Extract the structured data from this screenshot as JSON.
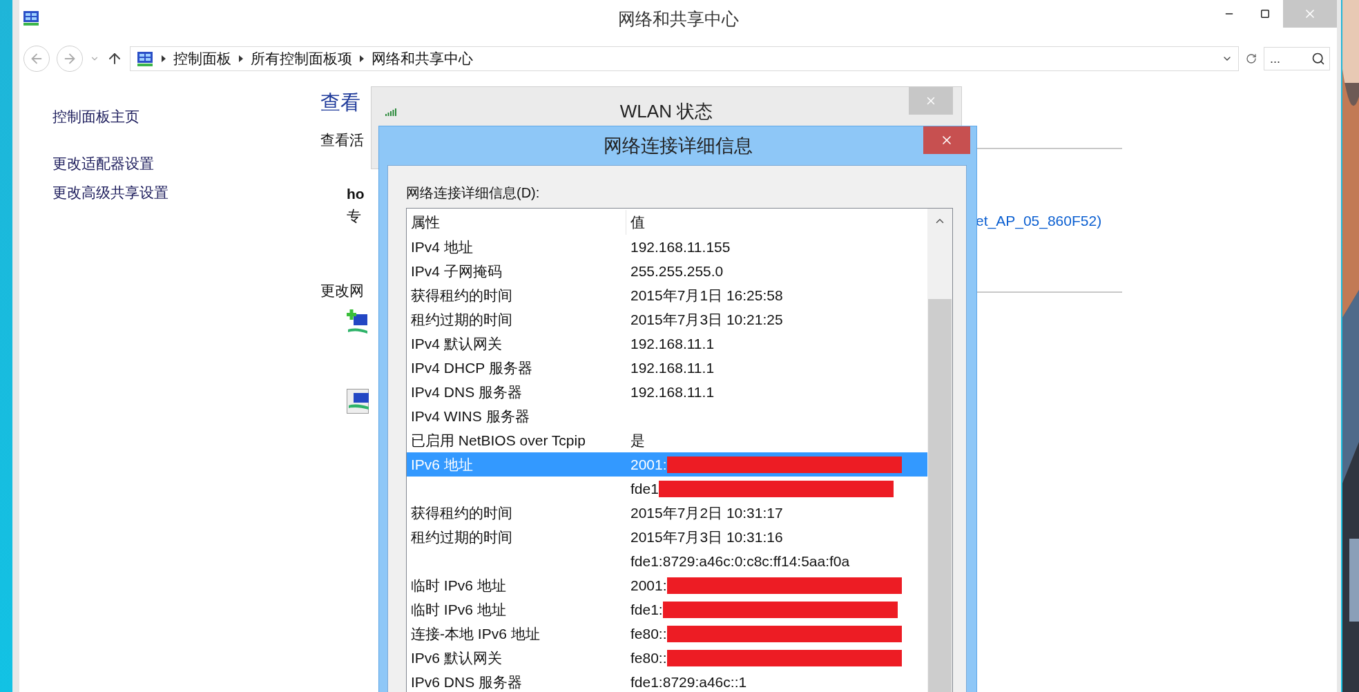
{
  "window": {
    "title": "网络和共享中心"
  },
  "address_bar": {
    "breadcrumbs": [
      "控制面板",
      "所有控制面板项",
      "网络和共享中心"
    ],
    "search_placeholder": "..."
  },
  "sidebar": {
    "links": [
      "控制面板主页",
      "更改适配器设置",
      "更改高级共享设置"
    ]
  },
  "main": {
    "heading": "查看",
    "section_label": "查看活",
    "network_name": "ho",
    "network_type": "专",
    "change_label": "更改网",
    "connection_link": "et_AP_05_860F52)"
  },
  "wlan_dialog": {
    "title": "WLAN 状态"
  },
  "details_dialog": {
    "title": "网络连接详细信息",
    "list_label": "网络连接详细信息(D):",
    "columns": [
      "属性",
      "值"
    ],
    "rows": [
      {
        "property": "IPv4 地址",
        "value": "192.168.11.155",
        "selected": false
      },
      {
        "property": "IPv4 子网掩码",
        "value": "255.255.255.0",
        "selected": false
      },
      {
        "property": "获得租约的时间",
        "value": "2015年7月1日 16:25:58",
        "selected": false
      },
      {
        "property": "租约过期的时间",
        "value": "2015年7月3日 10:21:25",
        "selected": false
      },
      {
        "property": "IPv4 默认网关",
        "value": "192.168.11.1",
        "selected": false
      },
      {
        "property": "IPv4 DHCP 服务器",
        "value": "192.168.11.1",
        "selected": false
      },
      {
        "property": "IPv4 DNS 服务器",
        "value": "192.168.11.1",
        "selected": false
      },
      {
        "property": "IPv4 WINS 服务器",
        "selected": false
      },
      {
        "property": "已启用 NetBIOS over Tcpip",
        "value": "是",
        "selected": false
      },
      {
        "property": "IPv6 地址",
        "value": "2001:",
        "selected": true,
        "redacted": true
      },
      {
        "value": "fde1",
        "selected": false,
        "redacted": true
      },
      {
        "property": "获得租约的时间",
        "value": "2015年7月2日 10:31:17",
        "selected": false
      },
      {
        "property": "租约过期的时间",
        "value": "2015年7月3日 10:31:16",
        "selected": false
      },
      {
        "value": "fde1:8729:a46c:0:c8c:ff14:5aa:f0a",
        "selected": false
      },
      {
        "property": "临时 IPv6 地址",
        "value": "2001:",
        "selected": false,
        "redacted": true
      },
      {
        "property": "临时 IPv6 地址",
        "value": "fde1:",
        "selected": false,
        "redacted": true
      },
      {
        "property": "连接-本地 IPv6 地址",
        "value": "fe80::",
        "selected": false,
        "redacted": true
      },
      {
        "property": "IPv6 默认网关",
        "value": "fe80::",
        "selected": false,
        "redacted": true
      },
      {
        "property": "IPv6 DNS 服务器",
        "value": "fde1:8729:a46c::1",
        "selected": false
      }
    ]
  }
}
